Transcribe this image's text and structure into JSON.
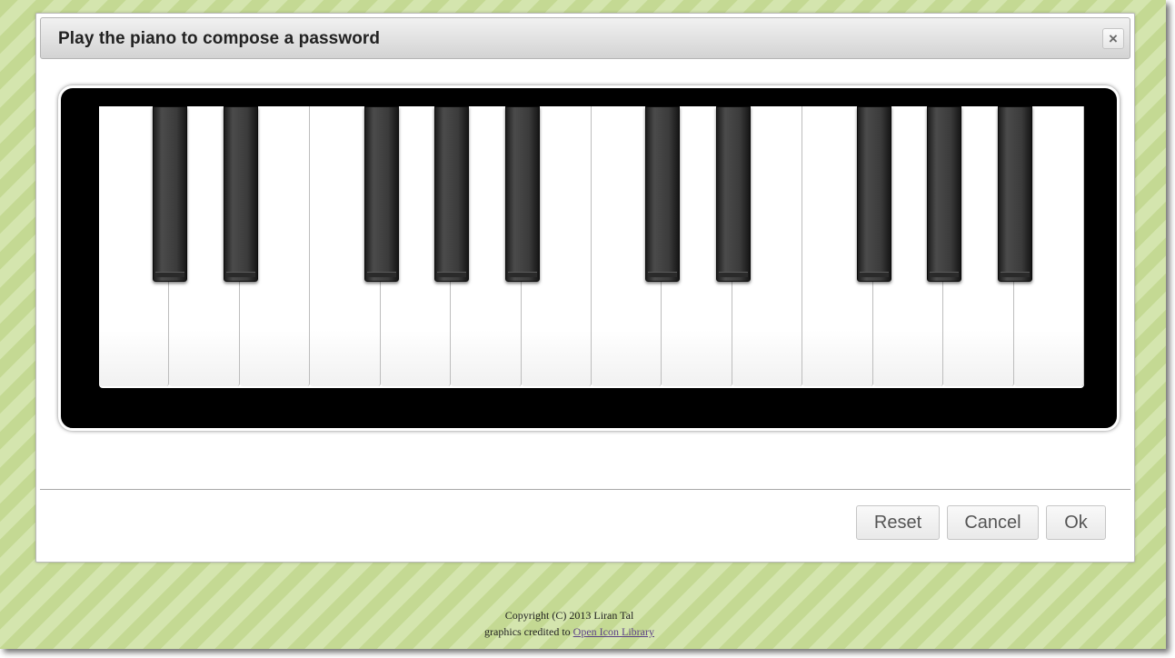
{
  "dialog": {
    "title": "Play the piano to compose a password",
    "close_symbol": "×"
  },
  "piano": {
    "white_keys": [
      "C",
      "D",
      "E",
      "F",
      "G",
      "A",
      "B",
      "C",
      "D",
      "E",
      "F",
      "G",
      "A",
      "B"
    ],
    "black_keys": [
      "C#",
      "D#",
      "F#",
      "G#",
      "A#",
      "C#",
      "D#",
      "F#",
      "G#",
      "A#"
    ]
  },
  "buttons": {
    "reset": "Reset",
    "cancel": "Cancel",
    "ok": "Ok"
  },
  "footer": {
    "copyright": "Copyright (C) 2013 Liran Tal",
    "credit_prefix": "graphics credited to ",
    "credit_link": "Open Icon Library"
  },
  "colors": {
    "page_background": "#cfe1a6",
    "piano_frame": "#000000"
  }
}
